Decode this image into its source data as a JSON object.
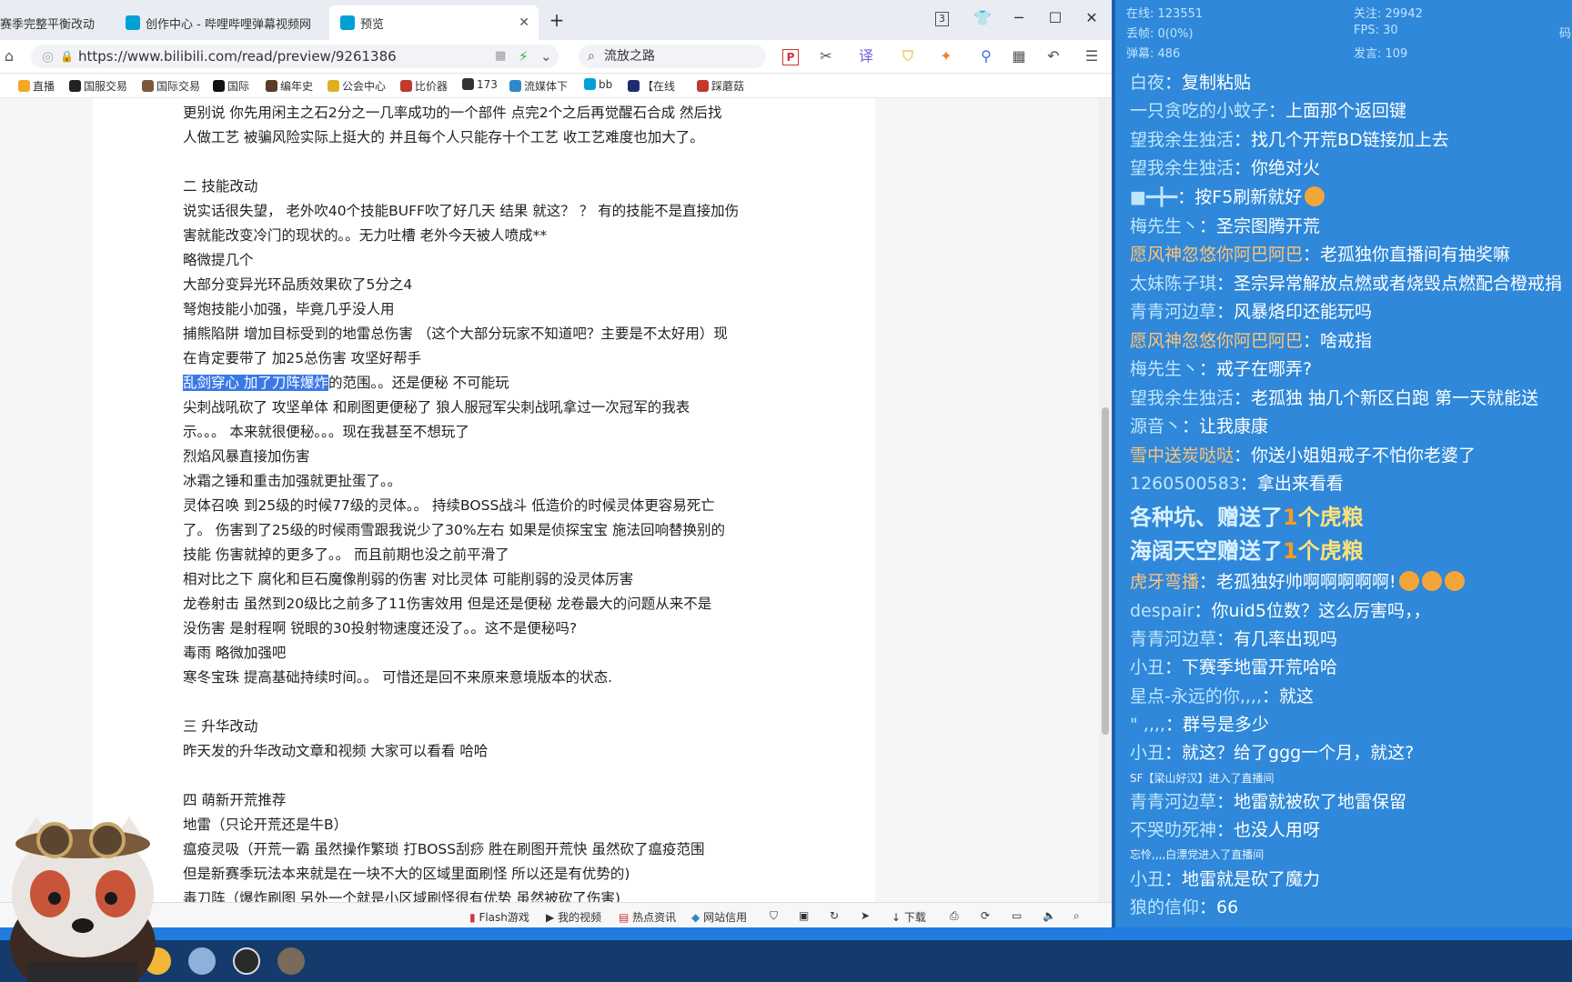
{
  "tabs": [
    {
      "label": "赛季完整平衡改动"
    },
    {
      "label": "创作中心 - 哔哩哔哩弹幕视频网"
    },
    {
      "label": "预览"
    }
  ],
  "tab_counter": "3",
  "address": {
    "url": "https://www.bilibili.com/read/preview/9261386"
  },
  "search": {
    "value": "流放之路"
  },
  "bookmarks": [
    "直播",
    "国服交易",
    "国际交易",
    "国际",
    "编年史",
    "公会中心",
    "比价器",
    "173",
    "流媒体下",
    "bb",
    "【在线",
    "踩蘑菇"
  ],
  "article": {
    "lines": [
      "更别说  你先用闲主之石2分之一几率成功的一个部件 点完2个之后再觉醒石合成 然后找",
      "人做工艺  被骗风险实际上挺大的 并且每个人只能存十个工艺  收工艺难度也加大了。",
      "",
      "二 技能改动",
      "说实话很失望，  老外吹40个技能BUFF吹了好几天 结果 就这？ ？  有的技能不是直接加伤",
      "害就能改变冷门的现状的。。无力吐槽 老外今天被人喷成**",
      "略微提几个",
      "大部分变异光环品质效果砍了5分之4",
      "弩炮技能小加强，毕竟几乎没人用",
      "捕熊陷阱 增加目标受到的地雷总伤害 （这个大部分玩家不知道吧？主要是不太好用）现",
      "在肯定要带了 加25总伤害    攻坚好帮手",
      "",
      "尖刺战吼砍了  攻坚单体 和刷图更便秘了 狼人服冠军尖刺战吼拿过一次冠军的我表",
      "示。。。 本来就很便秘。。。现在我甚至不想玩了",
      "烈焰风暴直接加伤害",
      "冰霜之锤和重击加强就更扯蛋了。。",
      "灵体召唤  到25级的时候77级的灵体。。 持续BOSS战斗 低造价的时候灵体更容易死亡",
      "了。 伤害到了25级的时候雨雪跟我说少了30%左右 如果是侦探宝宝  施法回响替换别的",
      "技能 伤害就掉的更多了。。 而且前期也没之前平滑了",
      "相对比之下  腐化和巨石魔像削弱的伤害 对比灵体 可能削弱的没灵体厉害",
      "龙卷射击 虽然到20级比之前多了11伤害效用  但是还是便秘  龙卷最大的问题从来不是",
      "没伤害  是射程啊  锐眼的30投射物速度还没了。。这不是便秘吗?",
      "毒雨 略微加强吧",
      "寒冬宝珠  提高基础持续时间。。 可惜还是回不来原来意境版本的状态.",
      "",
      "三 升华改动",
      "昨天发的升华改动文章和视频 大家可以看看 哈哈",
      "",
      "四 萌新开荒推荐",
      "地雷（只论开荒还是牛B）",
      "瘟疫灵吸（开荒一霸  虽然操作繁琐 打BOSS刮痧  胜在刷图开荒快  虽然砍了瘟疫范围",
      "但是新赛季玩法本来就是在一块不大的区域里面刷怪  所以还是有优势的)",
      "毒刀阵（爆炸刷图  另外一个就是小区域刷怪很有优势 虽然被砍了伤害)"
    ],
    "selected_text": "乱剑穿心  加了刀阵爆炸",
    "selected_rest": "的范围。。还是便秘 不可能玩"
  },
  "statusbar": [
    "Flash游戏",
    "我的视频",
    "热点资讯",
    "网站信用",
    "下载"
  ],
  "panel": {
    "stats": {
      "online_label": "在线: 123551",
      "follow_label": "关注: 29942",
      "drop_label": "丢帧: 0(0%)",
      "fps_label": "FPS: 30",
      "danmu_label": "弹幕: 486",
      "speak_label": "发言: 109",
      "edge_char": "码"
    },
    "chat": [
      {
        "name": "白夜",
        "msg": "复制粘贴",
        "type": "normal"
      },
      {
        "name": "一只贪吃的小蚊子",
        "msg": "上面那个返回键",
        "type": "normal"
      },
      {
        "name": "望我余生独活",
        "msg": "找几个开荒BD链接加上去",
        "type": "normal"
      },
      {
        "name": "望我余生独活",
        "msg": "你绝对火",
        "type": "normal"
      },
      {
        "name": "■━╋━",
        "msg": "按F5刷新就好",
        "type": "normal"
      },
      {
        "name": "梅先生丶",
        "msg": "圣宗图腾开荒",
        "type": "normal"
      },
      {
        "name": "愿风神忽悠你阿巴阿巴",
        "msg": "老孤独你直播间有抽奖嘛",
        "type": "orange"
      },
      {
        "name": "太妹陈子琪",
        "msg": "圣宗异常解放点燃或者烧毁点燃配合橙戒捐",
        "type": "normal"
      },
      {
        "name": "青青河边草",
        "msg": "风暴烙印还能玩吗",
        "type": "normal"
      },
      {
        "name": "愿风神忽悠你阿巴阿巴",
        "msg": "啥戒指",
        "type": "orange"
      },
      {
        "name": "梅先生丶",
        "msg": "戒子在哪弄?",
        "type": "normal"
      },
      {
        "name": "望我余生独活",
        "msg": "老孤独  抽几个新区白跑  第一天就能送",
        "type": "normal"
      },
      {
        "name": "源音丶",
        "msg": "让我康康",
        "type": "normal"
      },
      {
        "name": "雪中送炭哒哒",
        "msg": "你送小姐姐戒子不怕你老婆了",
        "type": "orange"
      },
      {
        "name": "1260500583",
        "msg": "拿出来看看",
        "type": "normal"
      }
    ],
    "gifts": [
      {
        "name": "各种坑、",
        "verb": "赠送了",
        "num": "1",
        "item": "个虎粮"
      },
      {
        "name": "海阔天空",
        "verb": "赠送了",
        "num": "1",
        "item": "个虎粮"
      }
    ],
    "chat2": [
      {
        "name": "虎牙弯播",
        "msg": "老孤独好帅啊啊啊啊啊!",
        "type": "orange"
      },
      {
        "name": "despair",
        "msg": "你uid5位数？这么厉害吗，，",
        "type": "normal"
      },
      {
        "name": "青青河边草",
        "msg": "有几率出现吗",
        "type": "normal"
      },
      {
        "name": "小丑",
        "msg": "下赛季地雷开荒哈哈",
        "type": "normal"
      },
      {
        "name": "星点-永远的你,,,,",
        "msg": "就这",
        "type": "normal"
      },
      {
        "name": "  \" ,,,,",
        "msg": "群号是多少",
        "type": "normal"
      },
      {
        "name": "小丑",
        "msg": "就这？给了ggg一个月，就这?",
        "type": "normal"
      }
    ],
    "sys1": "SF【梁山好汉】进入了直播间",
    "chat3": [
      {
        "name": "青青河边草",
        "msg": "地雷就被砍了地雷保留",
        "type": "normal"
      },
      {
        "name": "不哭叻死神",
        "msg": "也没人用呀",
        "type": "normal"
      }
    ],
    "sys2": "忘怜,,,,白漂党进入了直播间",
    "chat4": [
      {
        "name": "小丑",
        "msg": "地雷就是砍了魔力",
        "type": "normal"
      },
      {
        "name": "狼的信仰",
        "msg": "66",
        "type": "normal"
      }
    ]
  },
  "colors": {
    "panel_bg": "#2f88d9",
    "selection": "#3b78e7",
    "taskbar": "#143b6b"
  }
}
